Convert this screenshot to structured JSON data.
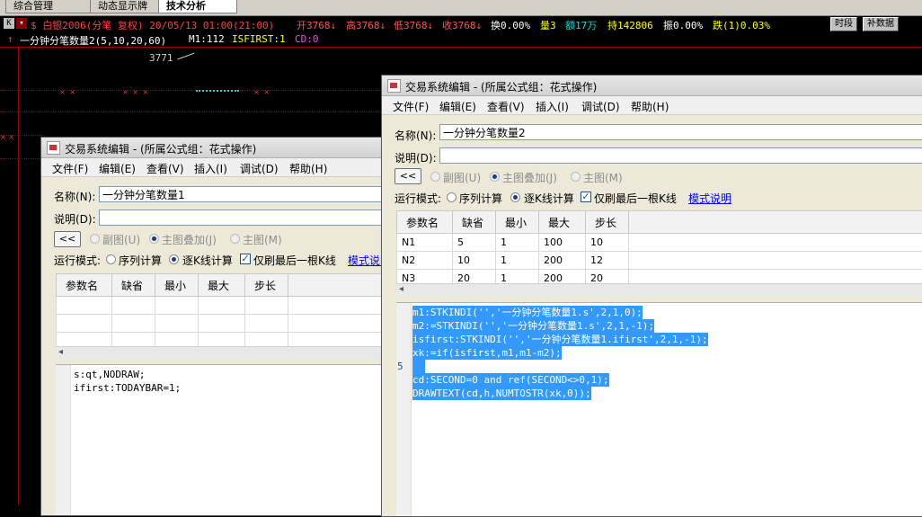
{
  "tabs": [
    {
      "label": "综合管理",
      "active": false
    },
    {
      "label": "动态显示牌",
      "active": false
    },
    {
      "label": "技术分析",
      "active": true
    }
  ],
  "quote": {
    "k_label": "K",
    "name": "$ 白银2006(分笔 复权) 20/05/13 01:00(21:00)",
    "open": "开3768↓",
    "high": "高3768↓",
    "low": "低3768↓",
    "close": "收3768↓",
    "turnover": "换0.00%",
    "volume": "量3",
    "amount": "额17万",
    "hold": "持142806",
    "amplitude": "振0.00%",
    "change": "跌(1)0.03%",
    "btn_time": "时段",
    "btn_fill": "补数据"
  },
  "indicator": {
    "arrow": "↑",
    "name": "一分钟分笔数量2(5,10,20,60)",
    "m1": "M1:112",
    "isfirst": "ISFIRST:1",
    "cd": "CD:0"
  },
  "chart": {
    "price_label": "3771",
    "marks": [
      "× ×",
      "× × ×",
      "× ×"
    ]
  },
  "window_left": {
    "title": "交易系统编辑 - (所属公式组：花式操作)",
    "menu": [
      "文件(F)",
      "编辑(E)",
      "查看(V)",
      "插入(I)",
      "调试(D)",
      "帮助(H)"
    ],
    "name_label": "名称(N):",
    "name_value": "一分钟分笔数量1",
    "desc_label": "说明(D):",
    "collapse_btn": "<<",
    "chart_options": [
      "副图(U)",
      "主图叠加(J)",
      "主图(M)"
    ],
    "run_mode_label": "运行模式:",
    "run_modes": [
      "序列计算",
      "逐K线计算"
    ],
    "last_bar_only": "仅刷最后一根K线",
    "mode_link": "模式说明",
    "param_headers": [
      "参数名",
      "缺省",
      "最小",
      "最大",
      "步长"
    ],
    "params": [],
    "code": [
      "s:qt,NODRAW;",
      "ifirst:TODAYBAR=1;"
    ]
  },
  "window_right": {
    "title": "交易系统编辑 - (所属公式组：花式操作)",
    "menu": [
      "文件(F)",
      "编辑(E)",
      "查看(V)",
      "插入(I)",
      "调试(D)",
      "帮助(H)"
    ],
    "name_label": "名称(N):",
    "name_value": "一分钟分笔数量2",
    "desc_label": "说明(D):",
    "collapse_btn": "<<",
    "chart_options": [
      "副图(U)",
      "主图叠加(J)",
      "主图(M)"
    ],
    "run_mode_label": "运行模式:",
    "run_modes": [
      "序列计算",
      "逐K线计算"
    ],
    "last_bar_only": "仅刷最后一根K线",
    "mode_link": "模式说明",
    "param_headers": [
      "参数名",
      "缺省",
      "最小",
      "最大",
      "步长"
    ],
    "params": [
      [
        "N1",
        "5",
        "1",
        "100",
        "10"
      ],
      [
        "N2",
        "10",
        "1",
        "200",
        "12"
      ],
      [
        "N3",
        "20",
        "1",
        "200",
        "20"
      ]
    ],
    "line_number": "5",
    "code": [
      "m1:STKINDI('','一分钟分笔数量1.s',2,1,0);",
      "m2:=STKINDI('','一分钟分笔数量1.s',2,1,-1);",
      "isfirst:STKINDI('','一分钟分笔数量1.ifirst',2,1,-1);",
      "xk:=if(isfirst,m1,m1-m2);",
      "",
      "cd:SECOND=0 and ref(SECOND<>0,1);",
      "DRAWTEXT(cd,h,NUMTOSTR(xk,0));"
    ]
  }
}
